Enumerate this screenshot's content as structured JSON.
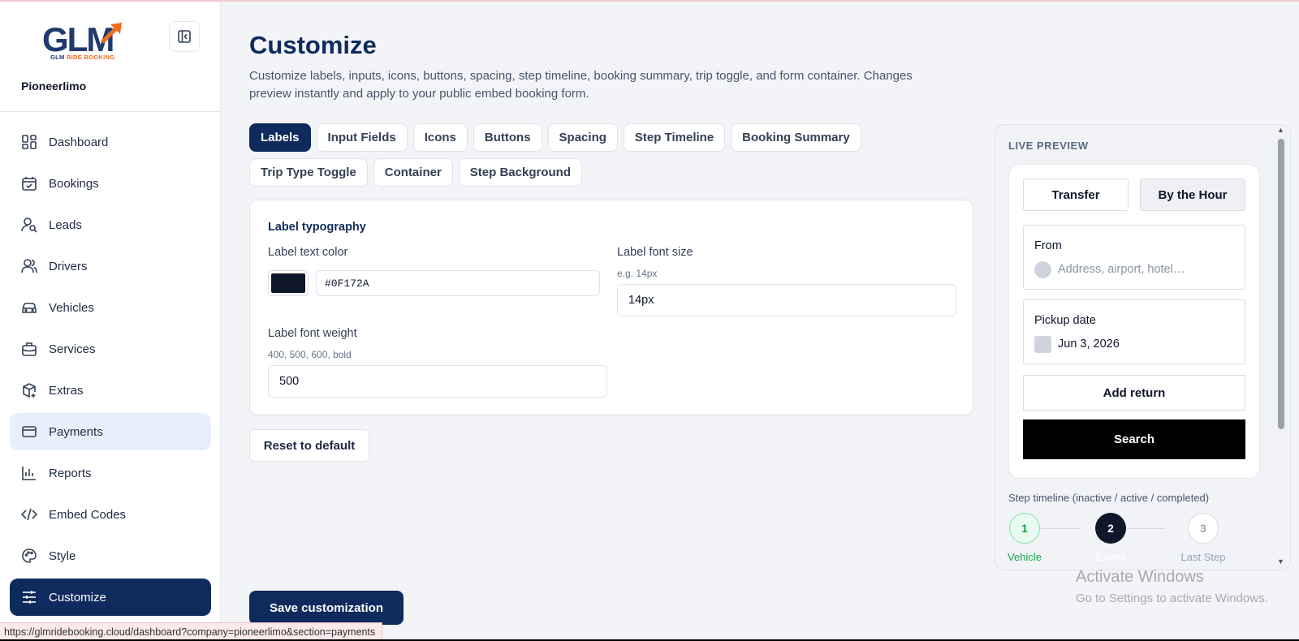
{
  "brand": {
    "logo_text": "GLM",
    "logo_sub_a": "GLM ",
    "logo_sub_b": "RIDE BOOKING",
    "company": "Pioneerlimo"
  },
  "sidebar": {
    "items": [
      {
        "label": "Dashboard",
        "icon": "dashboard-icon"
      },
      {
        "label": "Bookings",
        "icon": "calendar-check-icon"
      },
      {
        "label": "Leads",
        "icon": "user-search-icon"
      },
      {
        "label": "Drivers",
        "icon": "users-icon"
      },
      {
        "label": "Vehicles",
        "icon": "car-icon"
      },
      {
        "label": "Services",
        "icon": "briefcase-icon"
      },
      {
        "label": "Extras",
        "icon": "package-plus-icon"
      },
      {
        "label": "Payments",
        "icon": "credit-card-icon"
      },
      {
        "label": "Reports",
        "icon": "bar-chart-icon"
      },
      {
        "label": "Embed Codes",
        "icon": "code-icon"
      },
      {
        "label": "Style",
        "icon": "palette-icon"
      },
      {
        "label": "Customize",
        "icon": "sliders-icon"
      }
    ],
    "active": "Customize",
    "hovered": "Payments"
  },
  "main": {
    "title": "Customize",
    "description": "Customize labels, inputs, icons, buttons, spacing, step timeline, booking summary, trip toggle, and form container. Changes preview instantly and apply to your public embed booking form.",
    "tabs": [
      "Labels",
      "Input Fields",
      "Icons",
      "Buttons",
      "Spacing",
      "Step Timeline",
      "Booking Summary",
      "Trip Type Toggle",
      "Container",
      "Step Background"
    ],
    "active_tab": "Labels",
    "section_title": "Label typography",
    "fields": {
      "text_color": {
        "label": "Label text color",
        "value": "#0F172A"
      },
      "font_size": {
        "label": "Label font size",
        "hint": "e.g. 14px",
        "value": "14px"
      },
      "font_weight": {
        "label": "Label font weight",
        "hint": "400, 500, 600, bold",
        "value": "500"
      }
    },
    "reset_label": "Reset to default",
    "save_label": "Save customization"
  },
  "preview": {
    "title": "LIVE PREVIEW",
    "toggle_transfer": "Transfer",
    "toggle_hour": "By the Hour",
    "from_label": "From",
    "from_placeholder": "Address, airport, hotel…",
    "pickup_label": "Pickup date",
    "pickup_value": "Jun 3, 2026",
    "add_return": "Add return",
    "search": "Search",
    "steps_label": "Step timeline (inactive / active / completed)",
    "steps": [
      {
        "num": "1",
        "caption": "Vehicle"
      },
      {
        "num": "2",
        "caption": "Extras"
      },
      {
        "num": "3",
        "caption": "Last Step"
      }
    ]
  },
  "colors": {
    "primary": "#0f2a5c",
    "hover": "#e8effb",
    "completed": "#16a34a",
    "swatch": "#0F172A"
  },
  "system": {
    "watermark_title": "Activate Windows",
    "watermark_sub": "Go to Settings to activate Windows.",
    "status_url": "https://glmridebooking.cloud/dashboard?company=pioneerlimo&section=payments"
  }
}
